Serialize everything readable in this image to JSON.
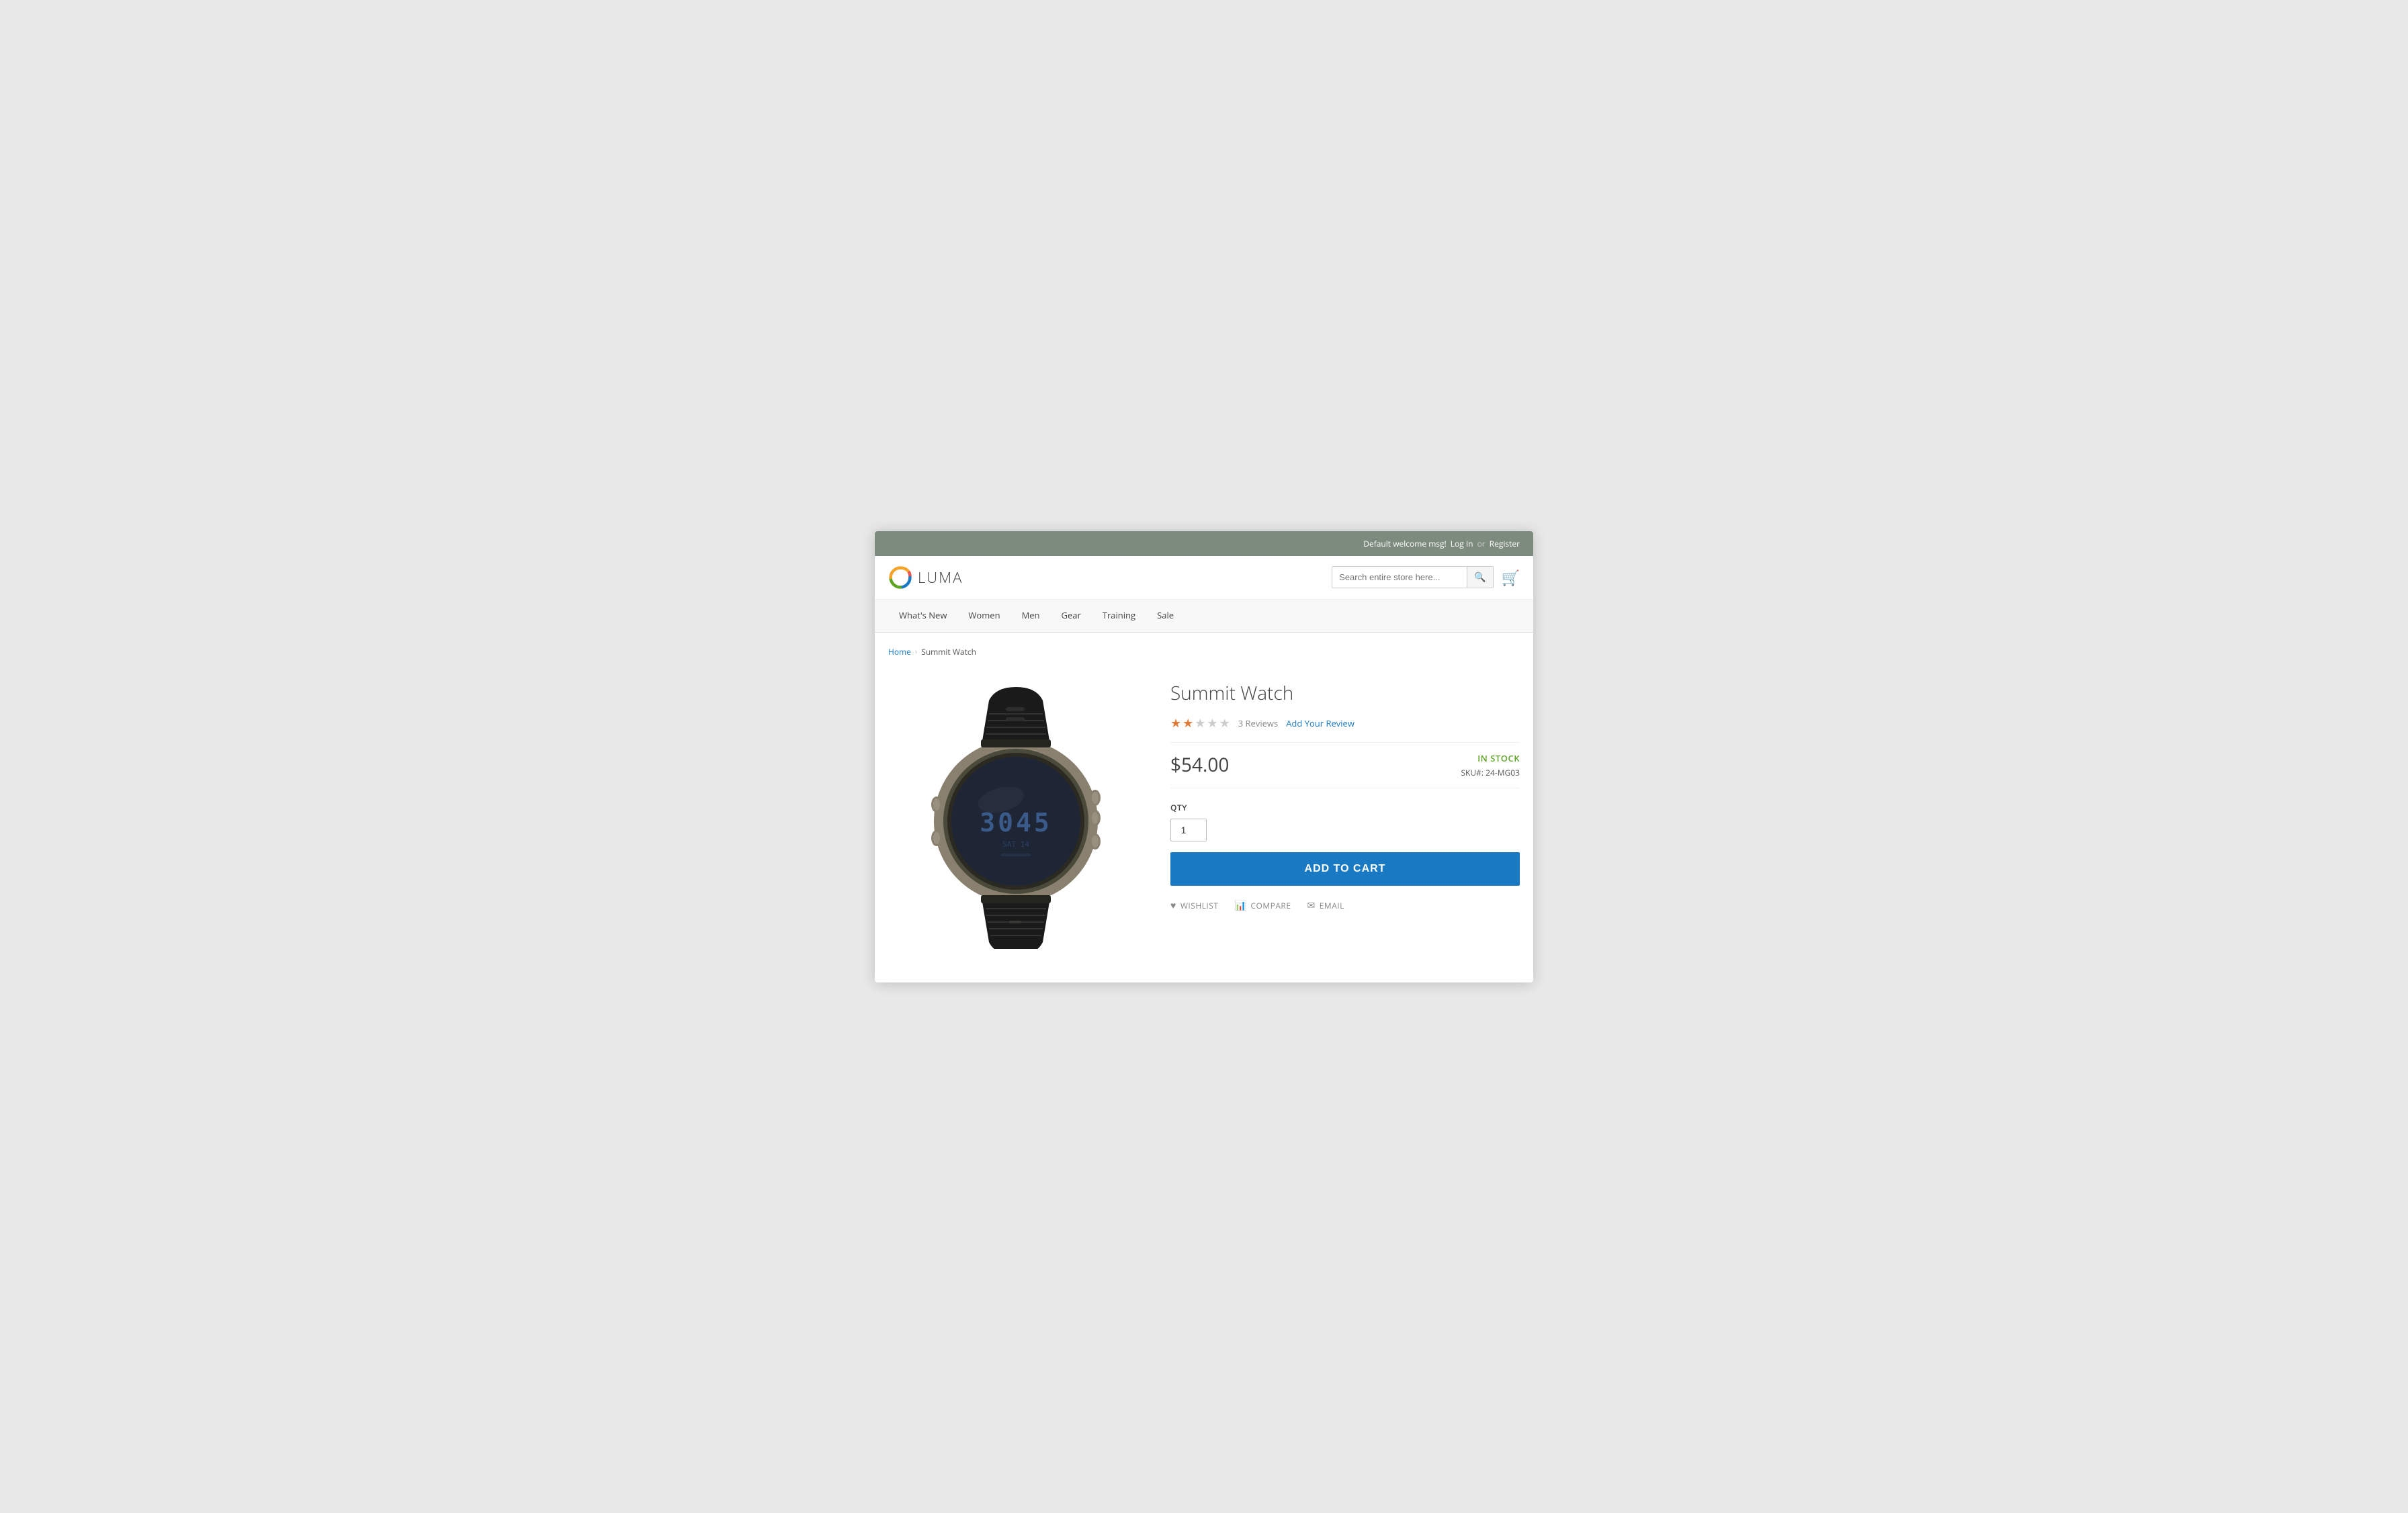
{
  "topbar": {
    "welcome": "Default welcome msg!",
    "login": "Log In",
    "separator": "or",
    "register": "Register"
  },
  "header": {
    "logo_text": "LUMA",
    "search_placeholder": "Search entire store here...",
    "search_btn_label": "🔍"
  },
  "nav": {
    "items": [
      {
        "label": "What's New"
      },
      {
        "label": "Women"
      },
      {
        "label": "Men"
      },
      {
        "label": "Gear"
      },
      {
        "label": "Training"
      },
      {
        "label": "Sale"
      }
    ]
  },
  "breadcrumb": {
    "home": "Home",
    "current": "Summit Watch"
  },
  "product": {
    "title": "Summit Watch",
    "rating": 2,
    "max_rating": 5,
    "reviews_count": "3 Reviews",
    "add_review": "Add Your Review",
    "price": "$54.00",
    "stock_status": "IN STOCK",
    "sku_label": "SKU#:",
    "sku_value": "24-MG03",
    "qty_label": "Qty",
    "qty_value": "1",
    "add_to_cart": "Add to Cart",
    "wishlist": "WISHLIST",
    "compare": "COMPARE",
    "email": "EMAIL"
  }
}
